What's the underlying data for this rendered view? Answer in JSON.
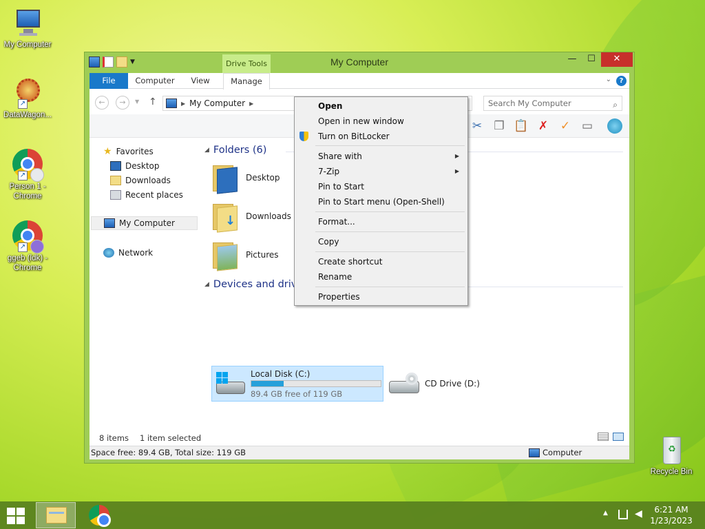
{
  "desktop": {
    "icons": [
      {
        "label": "My Computer"
      },
      {
        "label": "DataWagon..."
      },
      {
        "label": "Person 1 - Chrome"
      },
      {
        "label": "ggeb (ldk) - Chrome"
      },
      {
        "label": "Recycle Bin"
      }
    ]
  },
  "window": {
    "title": "My Computer",
    "contextual_tab_group": "Drive Tools",
    "tabs": [
      "File",
      "Computer",
      "View",
      "Manage"
    ],
    "controls": {
      "minimize": "—",
      "maximize": "☐",
      "close": "✕"
    },
    "help_glyph": "?",
    "address": {
      "breadcrumb": "My Computer"
    },
    "search": {
      "placeholder": "Search My Computer"
    },
    "nav": {
      "favorites": "Favorites",
      "favorites_items": [
        "Desktop",
        "Downloads",
        "Recent places"
      ],
      "computer": "My Computer",
      "network": "Network"
    },
    "folders_group": "Folders (6)",
    "folders": [
      "Desktop",
      "Downloads",
      "Pictures"
    ],
    "devices_group": "Devices and drives",
    "drives": [
      {
        "name": "Local Disk (C:)",
        "free": "89.4 GB free of 119 GB",
        "used_fraction": 0.25
      },
      {
        "name": "CD Drive (D:)"
      }
    ],
    "status": {
      "items": "8 items",
      "selected": "1 item selected",
      "space": "Space free: 89.4 GB, Total size: 119 GB",
      "location": "Computer"
    }
  },
  "context_menu": {
    "items": [
      {
        "label": "Open",
        "bold": true
      },
      {
        "label": "Open in new window"
      },
      {
        "label": "Turn on BitLocker"
      },
      {
        "label": "Share with",
        "submenu": true
      },
      {
        "label": "7-Zip",
        "submenu": true
      },
      {
        "label": "Pin to Start"
      },
      {
        "label": "Pin to Start menu (Open-Shell)"
      },
      {
        "label": "Format..."
      },
      {
        "label": "Copy"
      },
      {
        "label": "Create shortcut"
      },
      {
        "label": "Rename"
      },
      {
        "label": "Properties"
      }
    ],
    "submenu_arrow": "▶"
  },
  "taskbar": {
    "time": "6:21 AM",
    "date": "1/23/2023"
  },
  "colors": {
    "accent": "#1979ca",
    "close": "#c7302b",
    "window_frame": "#9fcd55",
    "selection": "#cce8ff",
    "drive_fill": "#26a0da"
  }
}
